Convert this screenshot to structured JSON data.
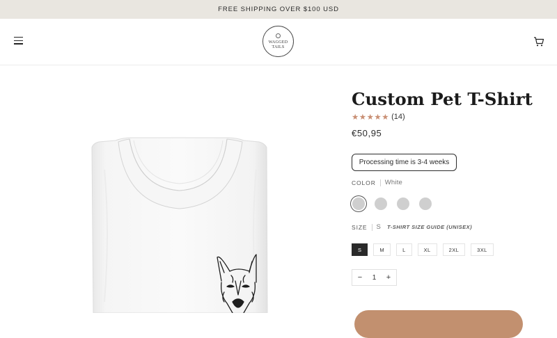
{
  "announcement": "FREE SHIPPING OVER $100 USD",
  "header": {
    "menu_icon": "hamburger-icon",
    "logo_line1": "WAGGED",
    "logo_line2": "TAILS",
    "cart_icon": "cart-icon"
  },
  "product": {
    "title": "Custom Pet T-Shirt",
    "stars": "★★★★★",
    "rating_count": "(14)",
    "rating_value": 5,
    "price": "€50,95",
    "processing": "Processing time is 3-4 weeks",
    "color_label": "COLOR",
    "color_value": "White",
    "size_label": "SIZE",
    "size_value": "S",
    "size_guide": "T-SHIRT SIZE GUIDE (UNISEX)",
    "sizes": [
      "S",
      "M",
      "L",
      "XL",
      "2XL",
      "3XL"
    ],
    "selected_size": "S",
    "quantity": "1",
    "qty_minus": "−",
    "qty_plus": "+"
  },
  "colors": {
    "accent": "#c2906f",
    "star": "#c98f74",
    "announcement_bg": "#e9e6e0"
  }
}
